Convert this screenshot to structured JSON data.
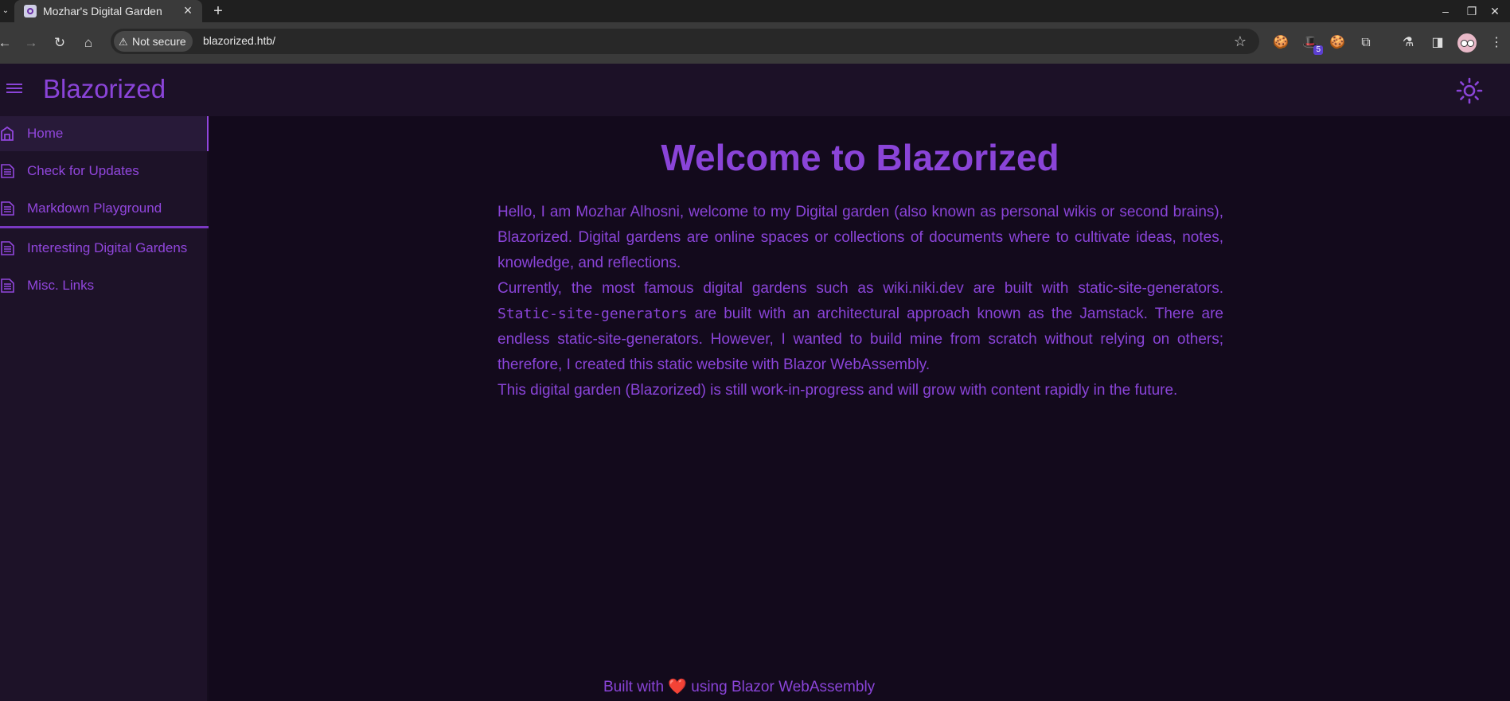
{
  "browser": {
    "tab_title": "Mozhar's Digital Garden",
    "security_label": "Not secure",
    "url": "blazorized.htb/",
    "extension_badge": "5"
  },
  "app": {
    "brand": "Blazorized"
  },
  "sidebar": {
    "items": [
      {
        "label": "Home",
        "icon": "home-icon"
      },
      {
        "label": "Check for Updates",
        "icon": "document-icon"
      },
      {
        "label": "Markdown Playground",
        "icon": "document-icon"
      },
      {
        "label": "Interesting Digital Gardens",
        "icon": "document-icon"
      },
      {
        "label": "Misc. Links",
        "icon": "document-icon"
      }
    ]
  },
  "main": {
    "title": "Welcome to Blazorized",
    "paragraph1": "Hello, I am Mozhar Alhosni, welcome to my Digital garden (also known as personal wikis or second brains), Blazorized. Digital gardens are online spaces or collections of documents where to cultivate ideas, notes, knowledge, and reflections.",
    "paragraph2_a": "Currently, the most famous digital gardens such as wiki.niki.dev are built with static-site-generators.",
    "paragraph2_code": "Static-site-generators",
    "paragraph2_b": " are built with an architectural approach known as the Jamstack. There are endless static-site-generators. However, I wanted to build mine from scratch without relying on others; therefore, I created this static website with Blazor WebAssembly.",
    "paragraph3": "This digital garden (Blazorized) is still work-in-progress and will grow with content rapidly in the future."
  },
  "footer": {
    "prefix": "Built with ",
    "heart": "❤️",
    "suffix": " using Blazor WebAssembly"
  },
  "colors": {
    "accent": "#8a44d8",
    "background": "#130a1c",
    "sidebar": "#1d1228",
    "appbar": "#1c1127"
  }
}
